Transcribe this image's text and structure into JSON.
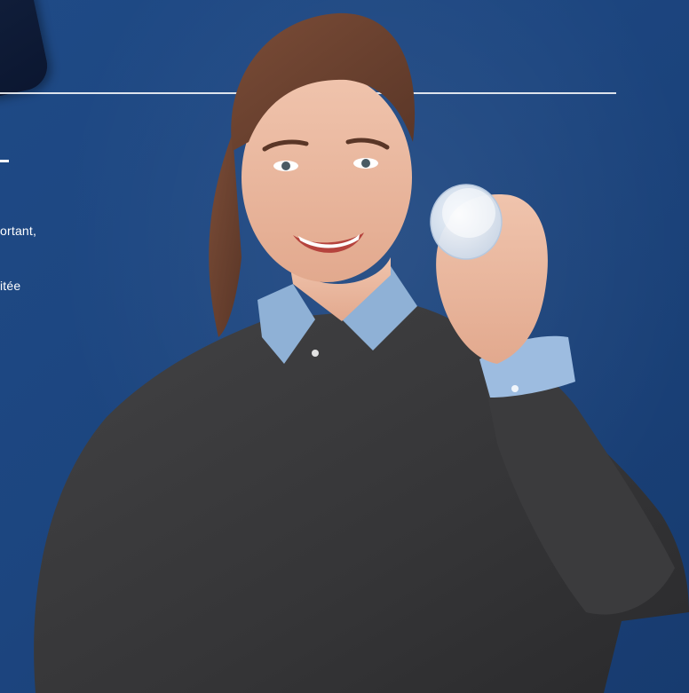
{
  "scene": {
    "background_color": "#1f4a86",
    "description_icon": "woman-holding-silicone-cup-photo"
  },
  "text_fragments": {
    "line_1": "ortant,",
    "line_2": "itée"
  },
  "colors": {
    "sweater": "#3a3a3c",
    "shirt_collar": "#8fb1d6",
    "skin": "#e9b79f",
    "hair": "#6b4331",
    "cup": "#e6eef7"
  }
}
